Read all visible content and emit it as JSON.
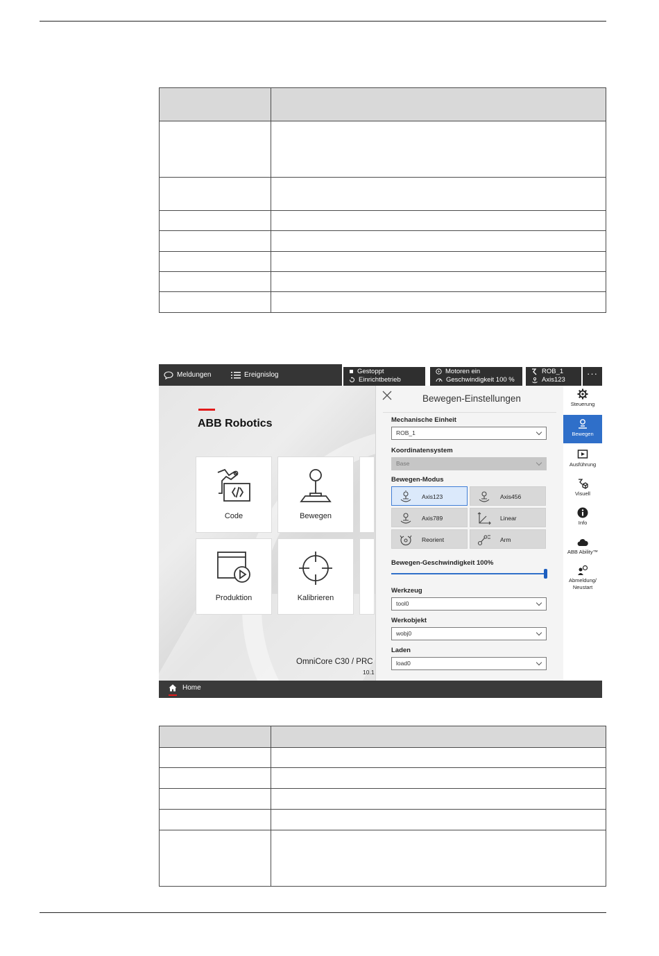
{
  "screen": {
    "topbar": {
      "messages_label": "Meldungen",
      "eventlog_label": "Ereignislog",
      "status1": {
        "line1": "Gestoppt",
        "line2": "Einrichtbetrieb"
      },
      "status2": {
        "line1": "Motoren ein",
        "line2": "Geschwindigkeit 100 %"
      },
      "status3": {
        "line1": "ROB_1",
        "line2": "Axis123"
      },
      "more_label": "···"
    },
    "home": {
      "brand": "ABB Robotics",
      "tiles": [
        "Code",
        "Bewegen",
        "Produktion",
        "Kalibrieren"
      ],
      "product": "OmniCore C30 / PRC",
      "version": "10.1"
    },
    "panel": {
      "title": "Bewegen-Einstellungen",
      "mech_unit_label": "Mechanische Einheit",
      "mech_unit_value": "ROB_1",
      "coord_label": "Koordinatensystem",
      "coord_value": "Base",
      "mode_label": "Bewegen-Modus",
      "modes": [
        "Axis123",
        "Axis456",
        "Axis789",
        "Linear",
        "Reorient",
        "Arm"
      ],
      "active_mode": "Axis123",
      "speed_label": "Bewegen-Geschwindigkeit 100%",
      "speed_percent": 100,
      "tool_label": "Werkzeug",
      "tool_value": "tool0",
      "wobj_label": "Werkobjekt",
      "wobj_value": "wobj0",
      "load_label": "Laden",
      "load_value": "load0"
    },
    "rail": {
      "items": [
        "Steuerung",
        "Bewegen",
        "Ausführung",
        "Visuell",
        "Info",
        "ABB Ability™",
        "Abmeldung/ Neustart"
      ],
      "active": "Bewegen"
    },
    "bottombar": {
      "home_label": "Home"
    }
  },
  "colors": {
    "accent": "#2f6fc9",
    "brand_red": "#e21a1a",
    "header_dark": "#353535",
    "table_header": "#d9d9d9"
  }
}
